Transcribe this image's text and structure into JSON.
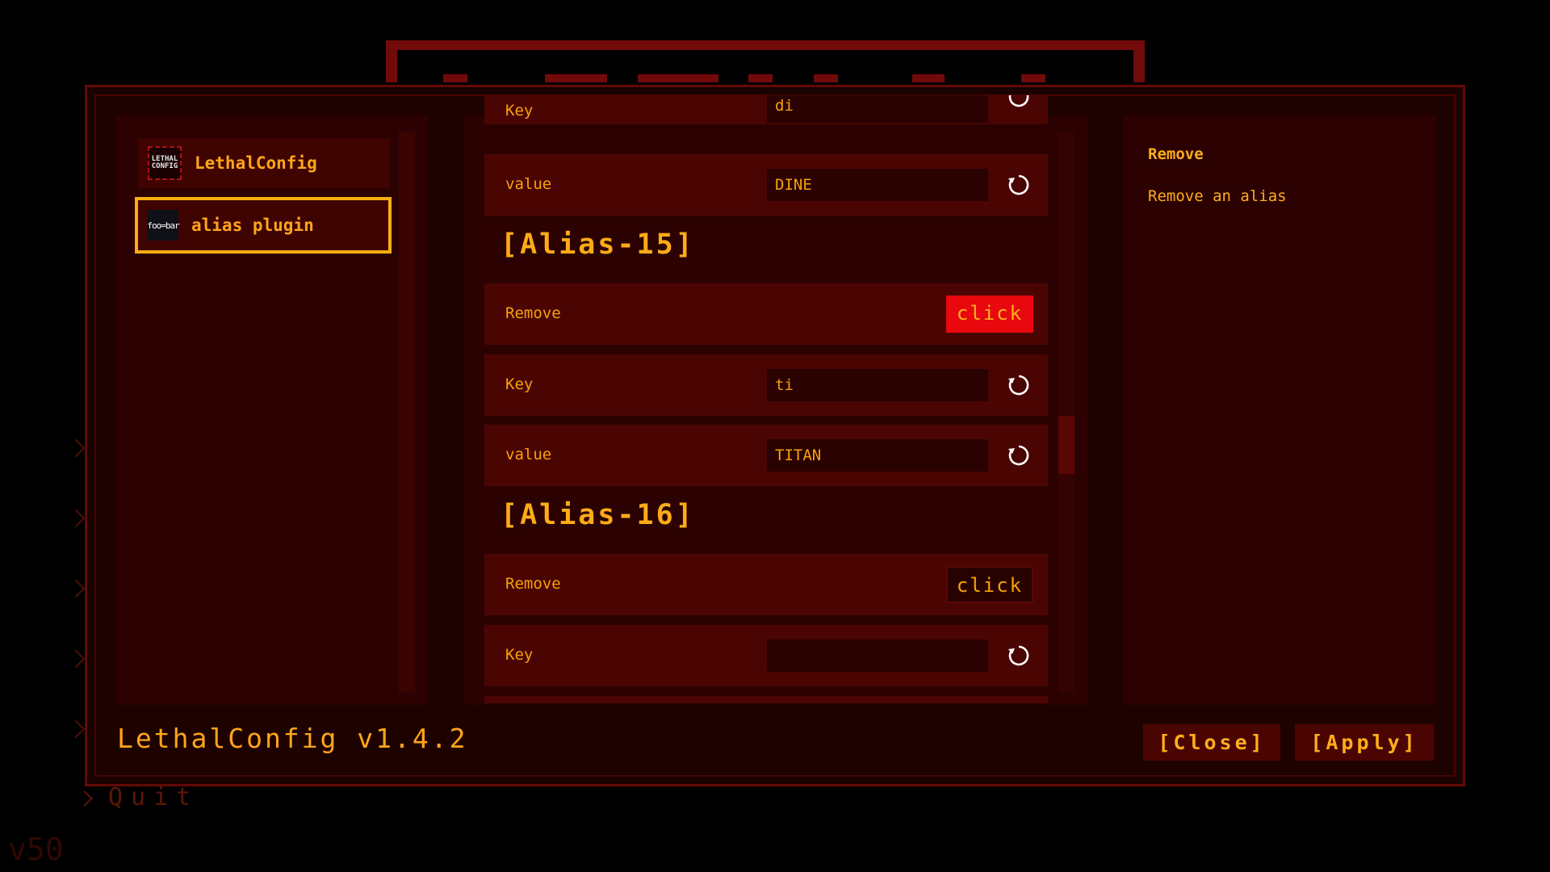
{
  "background": {
    "quit_label": "Quit",
    "version_label": "v50"
  },
  "mods": [
    {
      "name": "LethalConfig",
      "icon": "lethalconfig-logo-icon",
      "icon_text": "LETHAL CONFIG",
      "selected": false
    },
    {
      "name": "alias plugin",
      "icon": "foobar-logo-icon",
      "icon_text": "foo=bar",
      "selected": true
    }
  ],
  "config": {
    "partial_top": {
      "label": "Key",
      "value": "di"
    },
    "rows": [
      {
        "label": "value",
        "value": "DINE"
      },
      {
        "section": "[Alias-15]"
      },
      {
        "label": "Remove",
        "button": "click"
      },
      {
        "label": "Key",
        "value": "ti"
      },
      {
        "label": "value",
        "value": "TITAN"
      },
      {
        "section": "[Alias-16]"
      },
      {
        "label": "Remove",
        "button": "click"
      },
      {
        "label": "Key",
        "value": ""
      }
    ]
  },
  "description": {
    "title": "Remove",
    "text": "Remove an alias"
  },
  "footer": {
    "version": "LethalConfig v1.4.2",
    "close_label": "[Close]",
    "apply_label": "[Apply]"
  },
  "colors": {
    "accent": "#ffad12",
    "primary_button": "#e8080d",
    "panel": "#2b0201",
    "row": "#4a0503"
  }
}
